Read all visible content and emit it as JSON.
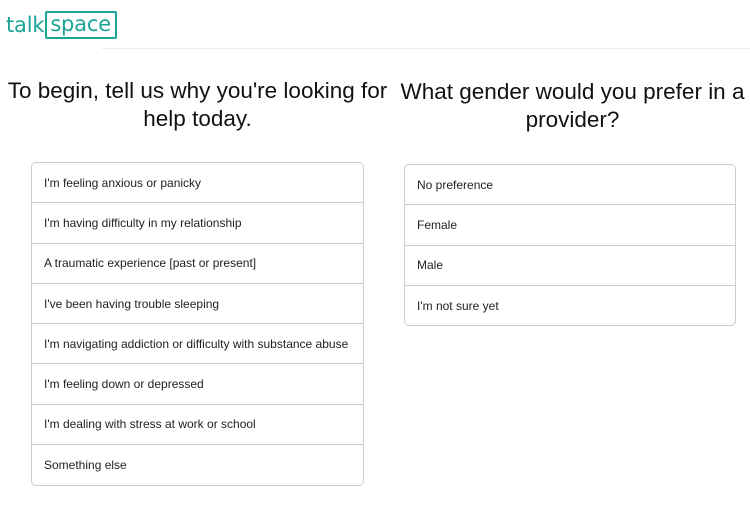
{
  "logo": {
    "text_plain": "talk",
    "text_boxed": "space"
  },
  "reason_question": {
    "line1": "To begin, tell us why you're looking for",
    "line2": "help today.",
    "options": [
      "I'm feeling anxious or panicky",
      "I'm having difficulty in my relationship",
      "A traumatic experience [past or present]",
      "I've been having trouble sleeping",
      "I'm navigating addiction or difficulty with substance abuse",
      "I'm feeling down or depressed",
      "I'm dealing with stress at work or school",
      "Something else"
    ]
  },
  "gender_question": {
    "line1": "What gender would you prefer in a",
    "line2": "provider?",
    "options": [
      "No preference",
      "Female",
      "Male",
      "I'm not sure yet"
    ]
  },
  "colors": {
    "brand": "#1aa596",
    "border": "#c9ccd3",
    "text": "#222222"
  }
}
